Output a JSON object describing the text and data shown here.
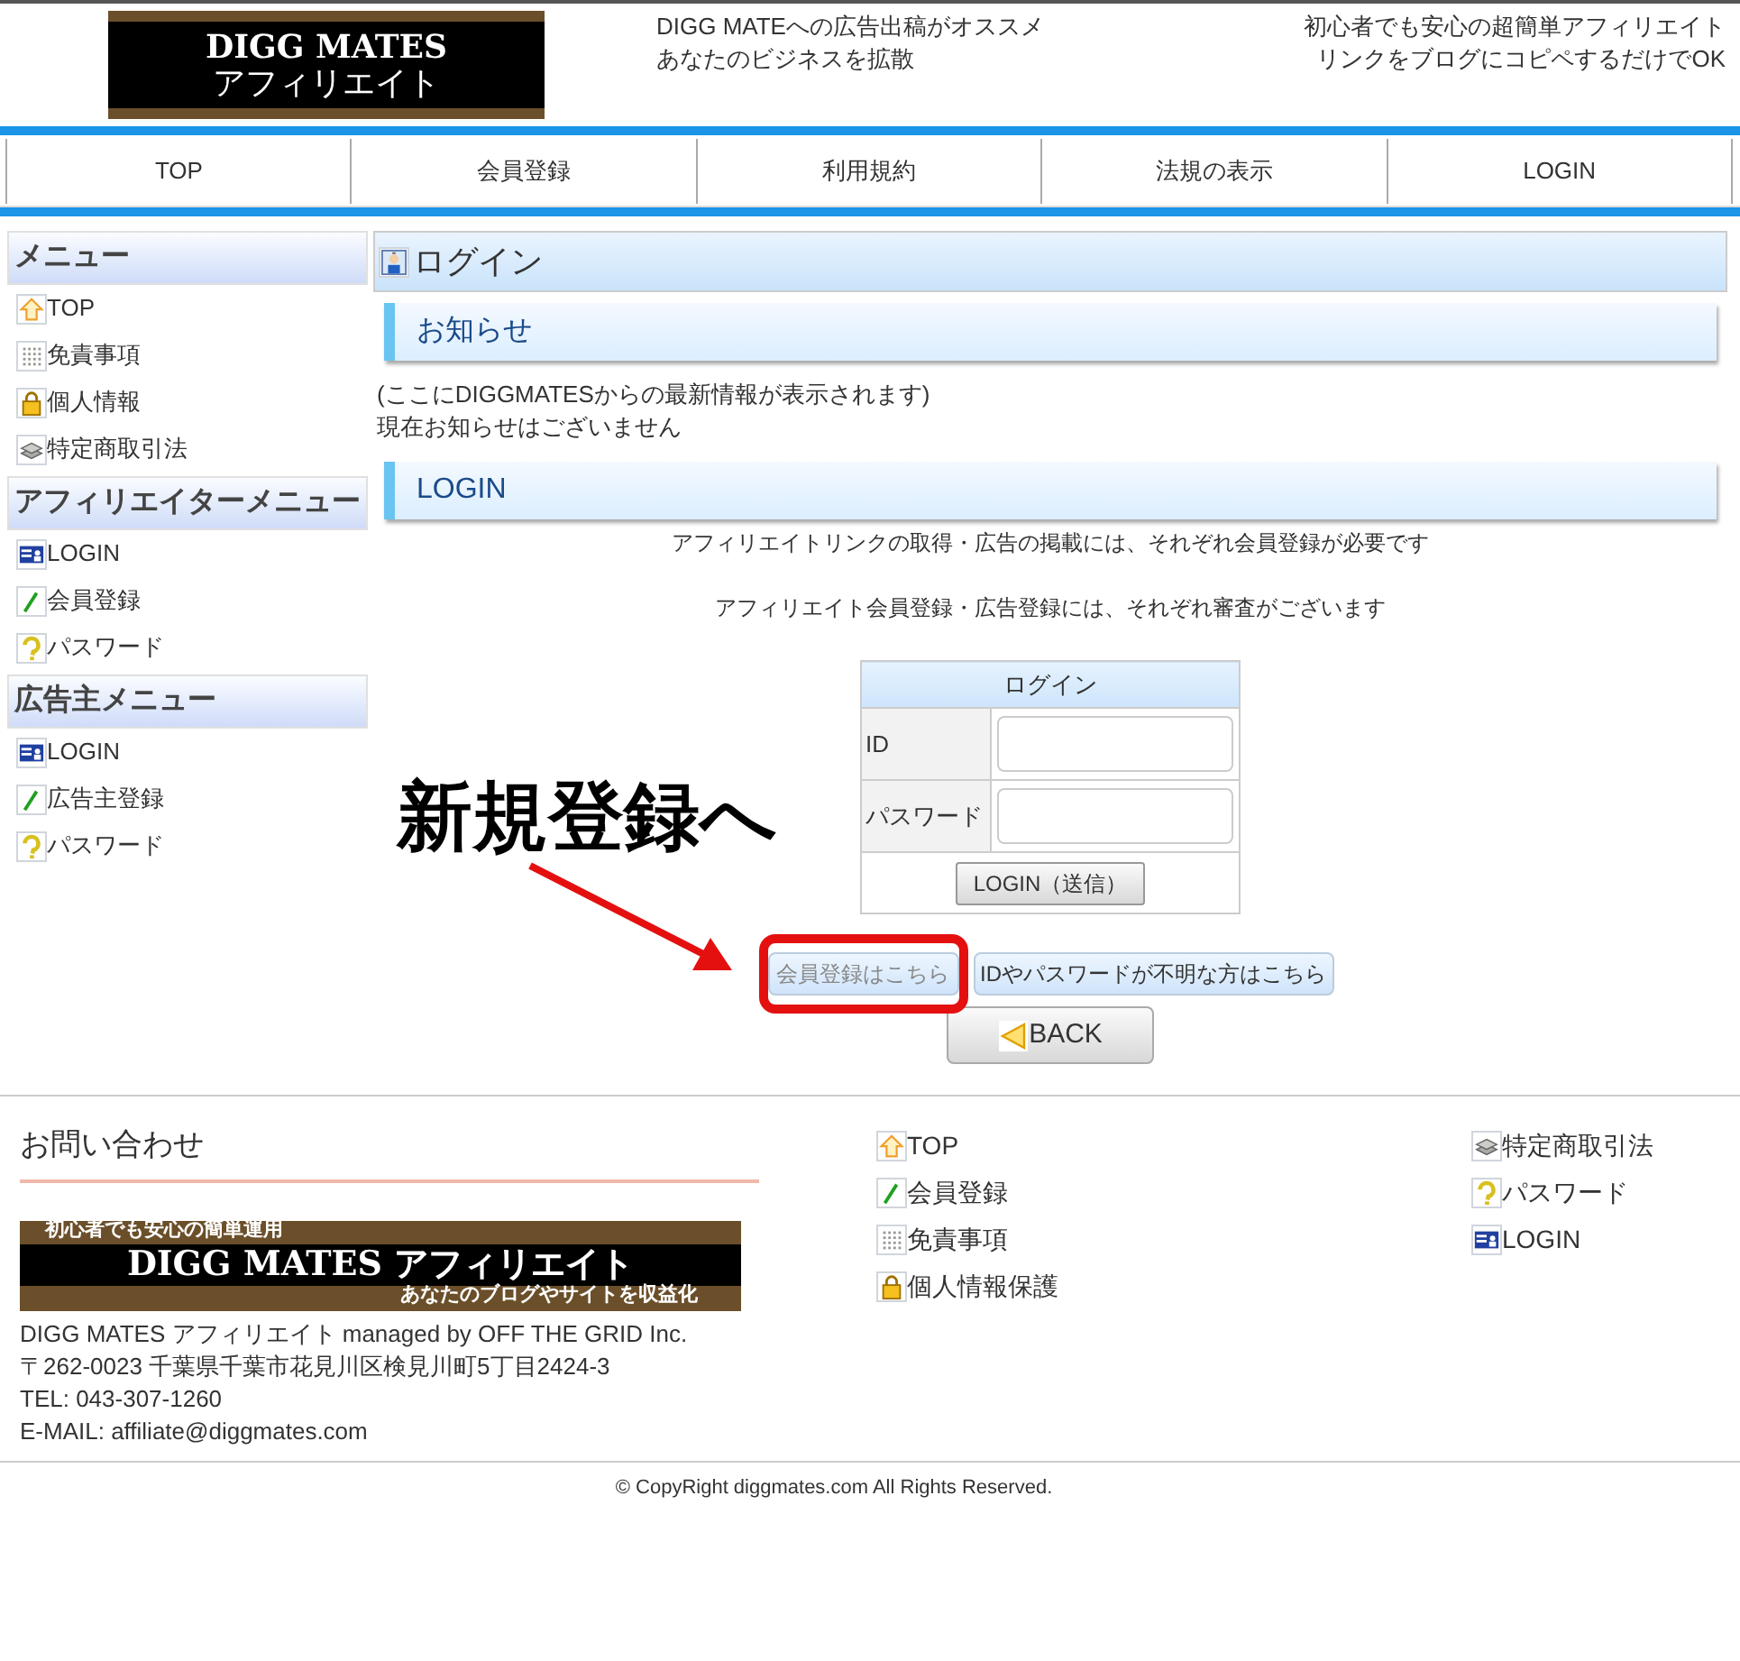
{
  "header": {
    "logo": {
      "line_1": "DIGG MATES",
      "line_2": "アフィリエイト"
    },
    "tagline_center": [
      "DIGG MATEへの広告出稿がオススメ",
      "あなたのビジネスを拡散"
    ],
    "tagline_right": [
      "初心者でも安心の超簡単アフィリエイト",
      "リンクをブログにコピペするだけでOK"
    ]
  },
  "nav": [
    "TOP",
    "会員登録",
    "利用規約",
    "法規の表示",
    "LOGIN"
  ],
  "sidebar": [
    {
      "heading": "メニュー",
      "items": [
        {
          "kind": "house",
          "label": "TOP"
        },
        {
          "kind": "grid",
          "label": "免責事項"
        },
        {
          "kind": "lock",
          "label": "個人情報"
        },
        {
          "kind": "stack",
          "label": "特定商取引法"
        }
      ]
    },
    {
      "heading": "アフィリエイターメニュー",
      "items": [
        {
          "kind": "card",
          "label": "LOGIN"
        },
        {
          "kind": "pencil",
          "label": "会員登録"
        },
        {
          "kind": "question",
          "label": "パスワード"
        }
      ]
    },
    {
      "heading": "広告主メニュー",
      "items": [
        {
          "kind": "card",
          "label": "LOGIN"
        },
        {
          "kind": "pencil",
          "label": "広告主登録"
        },
        {
          "kind": "question",
          "label": "パスワード"
        }
      ]
    }
  ],
  "main": {
    "title": "ログイン",
    "notice": {
      "heading": "お知らせ",
      "lines": [
        "(ここにDIGGMATESからの最新情報が表示されます)",
        "現在お知らせはございません"
      ]
    },
    "login": {
      "heading": "LOGIN",
      "lines": [
        "アフィリエイトリンクの取得・広告の掲載には、それぞれ会員登録が必要です",
        "アフィリエイト会員登録・広告登録には、それぞれ審査がございます"
      ],
      "form": {
        "title": "ログイン",
        "fields": [
          {
            "label": "ID"
          },
          {
            "label": "パスワード"
          }
        ],
        "submit": "LOGIN（送信）"
      },
      "links": [
        "会員登録はこちら",
        "IDやパスワードが不明な方はこちら"
      ],
      "back": "BACK"
    }
  },
  "annotation": {
    "text": "新規登録へ"
  },
  "footer": {
    "contact_heading": "お問い合わせ",
    "banner": {
      "top": "初心者でも安心の簡単運用",
      "middle": "DIGG MATES アフィリエイト",
      "bottom": "あなたのブログやサイトを収益化"
    },
    "address": [
      "DIGG MATES アフィリエイト managed by OFF THE GRID Inc.",
      "〒262-0023 千葉県千葉市花見川区検見川町5丁目2424-3",
      "TEL: 043-307-1260",
      "E-MAIL: affiliate@diggmates.com"
    ],
    "links_1": [
      {
        "kind": "house",
        "label": "TOP"
      },
      {
        "kind": "pencil",
        "label": "会員登録"
      },
      {
        "kind": "grid",
        "label": "免責事項"
      },
      {
        "kind": "lock",
        "label": "個人情報保護"
      }
    ],
    "links_2": [
      {
        "kind": "stack",
        "label": "特定商取引法"
      },
      {
        "kind": "question",
        "label": "パスワード"
      },
      {
        "kind": "card",
        "label": "LOGIN"
      }
    ],
    "copyright": "© CopyRight diggmates.com All Rights Reserved."
  }
}
